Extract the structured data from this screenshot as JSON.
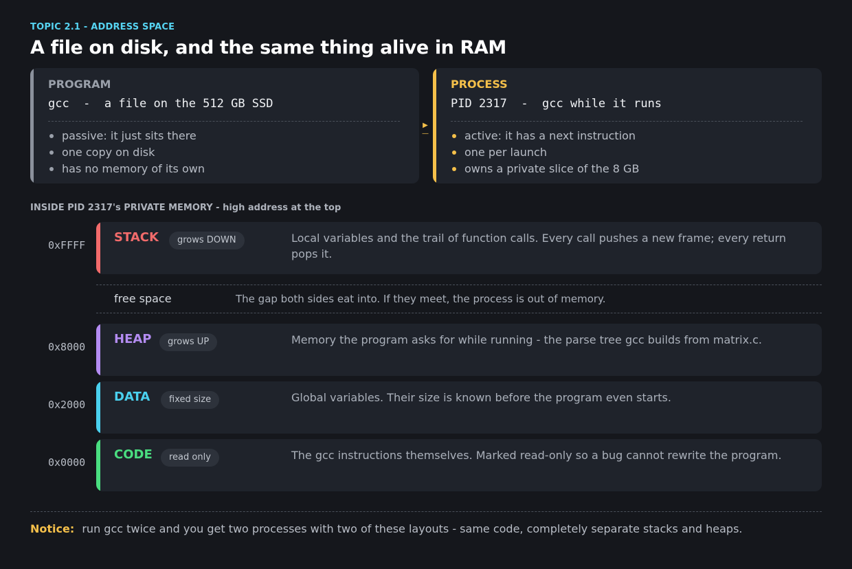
{
  "header": {
    "topic": "TOPIC 2.1  -  ADDRESS SPACE",
    "title": "A file on disk, and the same thing alive in RAM"
  },
  "program": {
    "title": "PROGRAM",
    "subtitle": "gcc  -  a file on the 512 GB SSD",
    "bullets": [
      "passive: it just sits there",
      "one copy on disk",
      "has no memory of its own"
    ]
  },
  "process": {
    "title": "PROCESS",
    "subtitle": "PID 2317  -  gcc while it runs",
    "bullets": [
      "active: it has a next instruction",
      "one per launch",
      "owns a private slice of the 8 GB"
    ]
  },
  "memory": {
    "label": "INSIDE PID 2317's PRIVATE MEMORY  -  high address at the top",
    "segments": [
      {
        "address": "0xFFFF",
        "name": "STACK",
        "badge": "grows DOWN",
        "color": "#f26b6b",
        "description": "Local variables and the trail of function calls. Every call pushes a new frame; every return pops it."
      },
      {
        "address": "0x8000",
        "name": "HEAP",
        "badge": "grows UP",
        "color": "#b48cf2",
        "description": "Memory the program asks for while running - the parse tree gcc builds from matrix.c."
      },
      {
        "address": "0x2000",
        "name": "DATA",
        "badge": "fixed size",
        "color": "#4ad0ee",
        "description": "Global variables. Their size is known before the program even starts."
      },
      {
        "address": "0x0000",
        "name": "CODE",
        "badge": "read only",
        "color": "#4ade80",
        "description": "The gcc instructions themselves. Marked read-only so a bug cannot rewrite the program."
      }
    ],
    "free_space": {
      "label": "free space",
      "description": "The gap both sides eat into. If they meet, the process is out of memory."
    }
  },
  "notice": {
    "label": "Notice:",
    "text": "run gcc twice and you get two processes with two of these layouts - same code, completely separate stacks and heaps."
  },
  "icons": {
    "arrow": "arrow-right-icon"
  }
}
